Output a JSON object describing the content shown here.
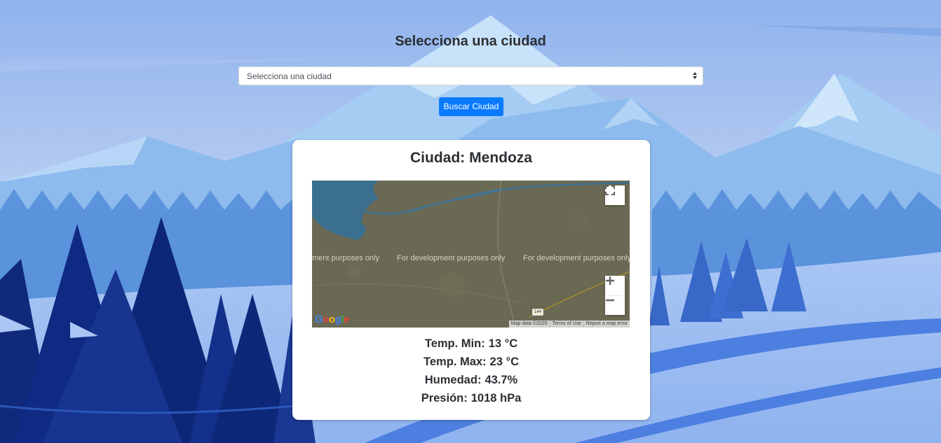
{
  "header": {
    "title": "Selecciona una ciudad"
  },
  "city_select": {
    "selected_value": "Selecciona una ciudad",
    "arrow_icon": "sort-arrows-icon"
  },
  "search_button": {
    "label": "Buscar Ciudad",
    "color": "#0a7bff"
  },
  "weather_card": {
    "city_label": "Ciudad:",
    "city_name": "Mendoza",
    "map": {
      "watermarks": [
        "ment purposes only",
        "For development purposes only",
        "For development purposes only"
      ],
      "logo": "Google",
      "footer": [
        "Map data ©2020",
        "Terms of Use",
        "Report a map error"
      ],
      "route_shield": "144",
      "fullscreen_icon": "fullscreen-icon",
      "zoom_in_icon": "plus-icon",
      "zoom_out_icon": "minus-icon"
    },
    "stats": [
      {
        "label": "Temp. Min:",
        "value": "13 °C"
      },
      {
        "label": "Temp. Max:",
        "value": "23 °C"
      },
      {
        "label": "Humedad:",
        "value": "43.7%"
      },
      {
        "label": "Presión:",
        "value": "1018 hPa"
      }
    ]
  },
  "colors": {
    "sky_top": "#8fb4ee",
    "mountains": "#8fc0f0",
    "forest_dark": "#0e2a7a",
    "snow": "#a8c8f5",
    "map_land": "#6b6a56",
    "map_water": "#3b6e8f"
  }
}
